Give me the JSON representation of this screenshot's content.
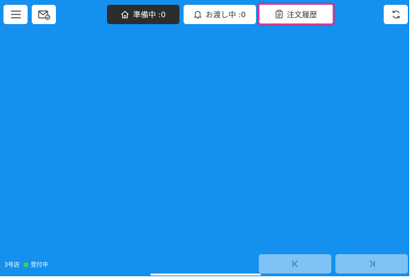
{
  "header": {
    "menu_icon": "hamburger-menu-icon",
    "mail_icon": "mail-check-icon",
    "refresh_icon": "refresh-icon",
    "tabs": [
      {
        "label": "準備中 :0",
        "icon": "home-icon"
      },
      {
        "label": "お渡し中 :0",
        "icon": "bell-icon"
      },
      {
        "label": "注文履歴",
        "icon": "clipboard-icon"
      }
    ]
  },
  "footer": {
    "store_name": "3号店",
    "status_text": "受付中",
    "first_page_icon": "first-page-icon",
    "last_page_icon": "last-page-icon"
  },
  "colors": {
    "background": "#1490ee",
    "active_tab_border": "#d8449c",
    "status_dot": "#3fd24a",
    "nav_button": "#7fc2f5"
  }
}
